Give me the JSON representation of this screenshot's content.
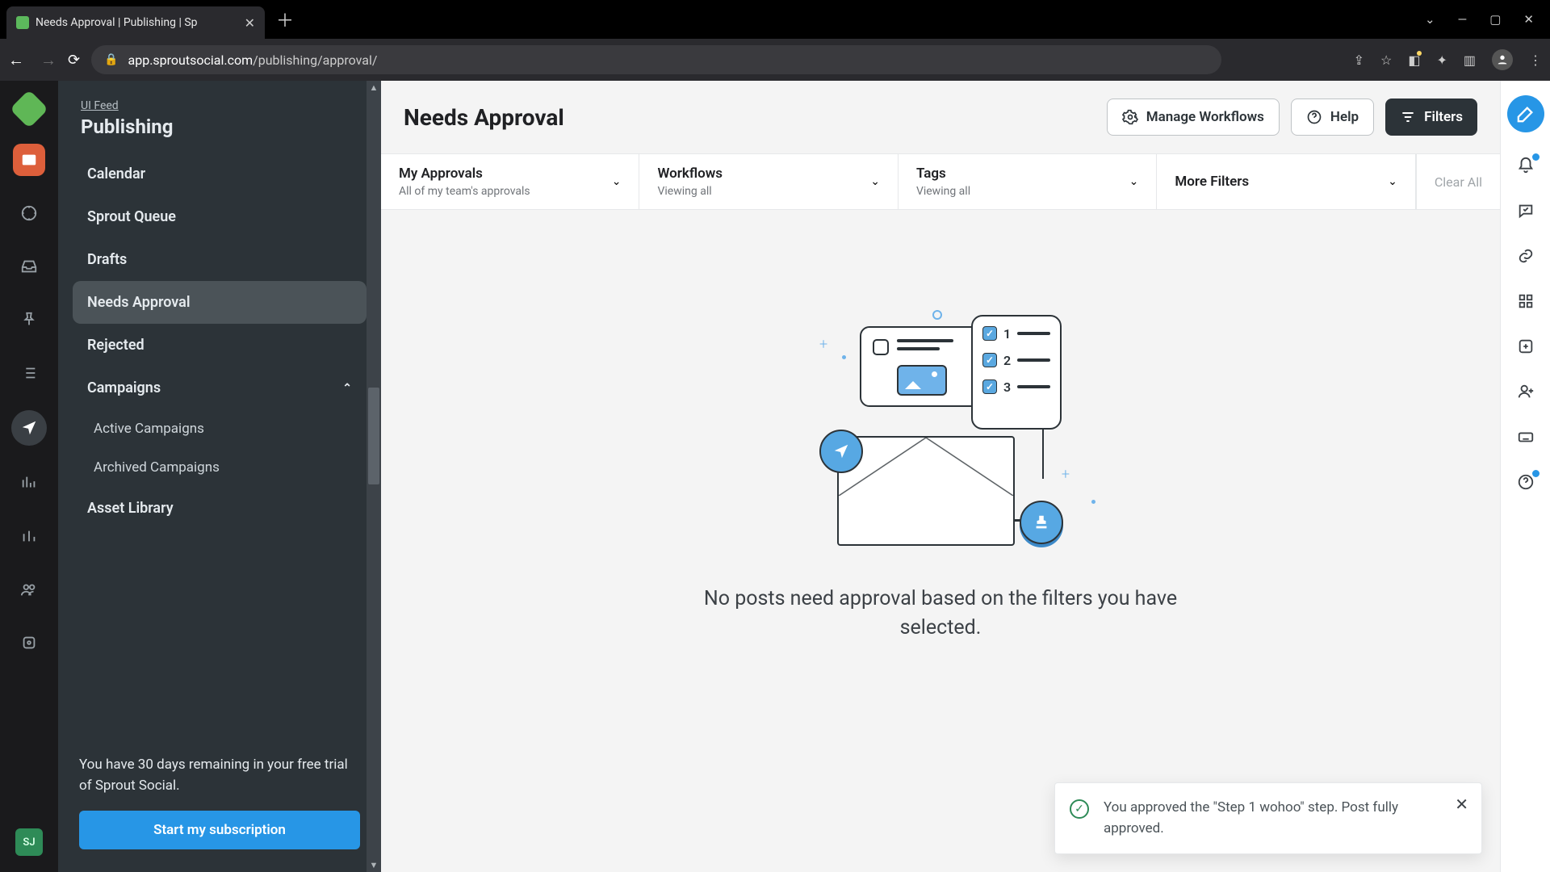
{
  "browser": {
    "tab_title": "Needs Approval | Publishing | Sp",
    "url_domain": "app.sproutsocial.com",
    "url_path": "/publishing/approval/"
  },
  "sidebar": {
    "ui_feed": "UI Feed",
    "section": "Publishing",
    "items": [
      {
        "label": "Calendar"
      },
      {
        "label": "Sprout Queue"
      },
      {
        "label": "Drafts"
      },
      {
        "label": "Needs Approval",
        "selected": true
      },
      {
        "label": "Rejected"
      }
    ],
    "campaigns_label": "Campaigns",
    "campaigns_items": [
      {
        "label": "Active Campaigns"
      },
      {
        "label": "Archived Campaigns"
      }
    ],
    "asset_library": "Asset Library",
    "trial_text": "You have 30 days remaining in your free trial of Sprout Social.",
    "trial_cta": "Start my subscription",
    "user_initials": "SJ"
  },
  "header": {
    "title": "Needs Approval",
    "manage_workflows": "Manage Workflows",
    "help": "Help",
    "filters": "Filters"
  },
  "filters": {
    "clear": "Clear All",
    "items": [
      {
        "label": "My Approvals",
        "sub": "All of my team's approvals"
      },
      {
        "label": "Workflows",
        "sub": "Viewing all"
      },
      {
        "label": "Tags",
        "sub": "Viewing all"
      },
      {
        "label": "More Filters",
        "sub": ""
      }
    ]
  },
  "empty_state": "No posts need approval based on the filters you have selected.",
  "toast": {
    "text": "You approved the \"Step 1 wohoo\" step. Post fully approved."
  },
  "checklist_numbers": [
    "1",
    "2",
    "3"
  ]
}
